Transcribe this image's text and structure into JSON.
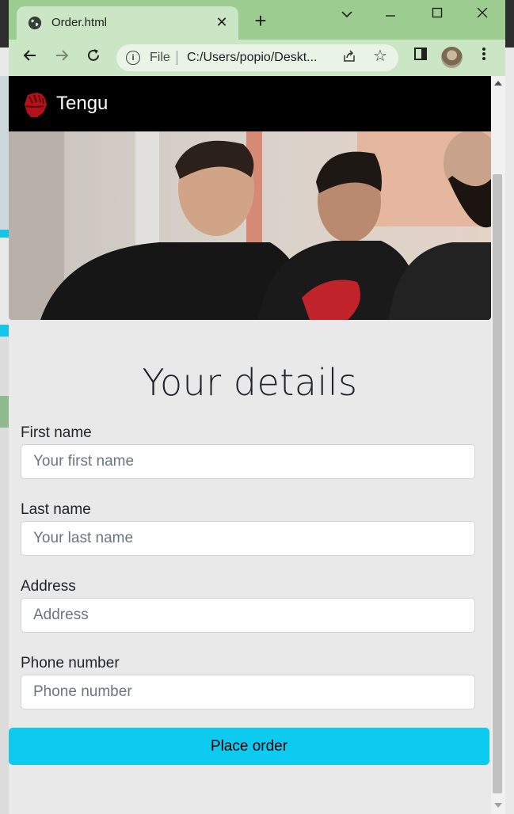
{
  "browser": {
    "tab_title": "Order.html",
    "new_tab_label": "+",
    "address_scheme": "File",
    "address_url": "C:/Users/popio/Deskt..."
  },
  "navbar": {
    "brand": "Tengu"
  },
  "form": {
    "heading": "Your details",
    "first_name": {
      "label": "First name",
      "placeholder": "Your first name"
    },
    "last_name": {
      "label": "Last name",
      "placeholder": "Your last name"
    },
    "address": {
      "label": "Address",
      "placeholder": "Address"
    },
    "phone": {
      "label": "Phone number",
      "placeholder": "Phone number"
    },
    "submit_label": "Place order"
  },
  "colors": {
    "titlebar": "#9ccc90",
    "toolbar": "#cbe6c4",
    "navbar": "#000000",
    "button": "#0dcaf0",
    "page_bg": "#e9e9e9"
  }
}
